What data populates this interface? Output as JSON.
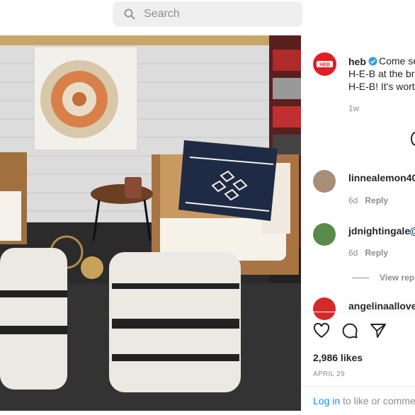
{
  "search": {
    "placeholder": "Search"
  },
  "post": {
    "author": "heb",
    "caption_lines": [
      "Come se",
      "H-E-B at the br",
      "H-E-B! It's wort"
    ],
    "time": "1w",
    "likes": "2,986 likes",
    "date": "APRIL 29"
  },
  "comments": [
    {
      "user": "linnealemon40",
      "time": "6d",
      "reply": "Reply"
    },
    {
      "user": "jdnightingale",
      "suffix": "@",
      "time": "6d",
      "reply": "Reply",
      "view_replies": "View repl"
    },
    {
      "user": "angelinaallover"
    }
  ],
  "footer": {
    "login_link": "Log in",
    "login_rest": " to like or comme"
  },
  "colors": {
    "accent": "#0095f6",
    "verified": "#3897f0",
    "heb_red": "#e21d24"
  }
}
